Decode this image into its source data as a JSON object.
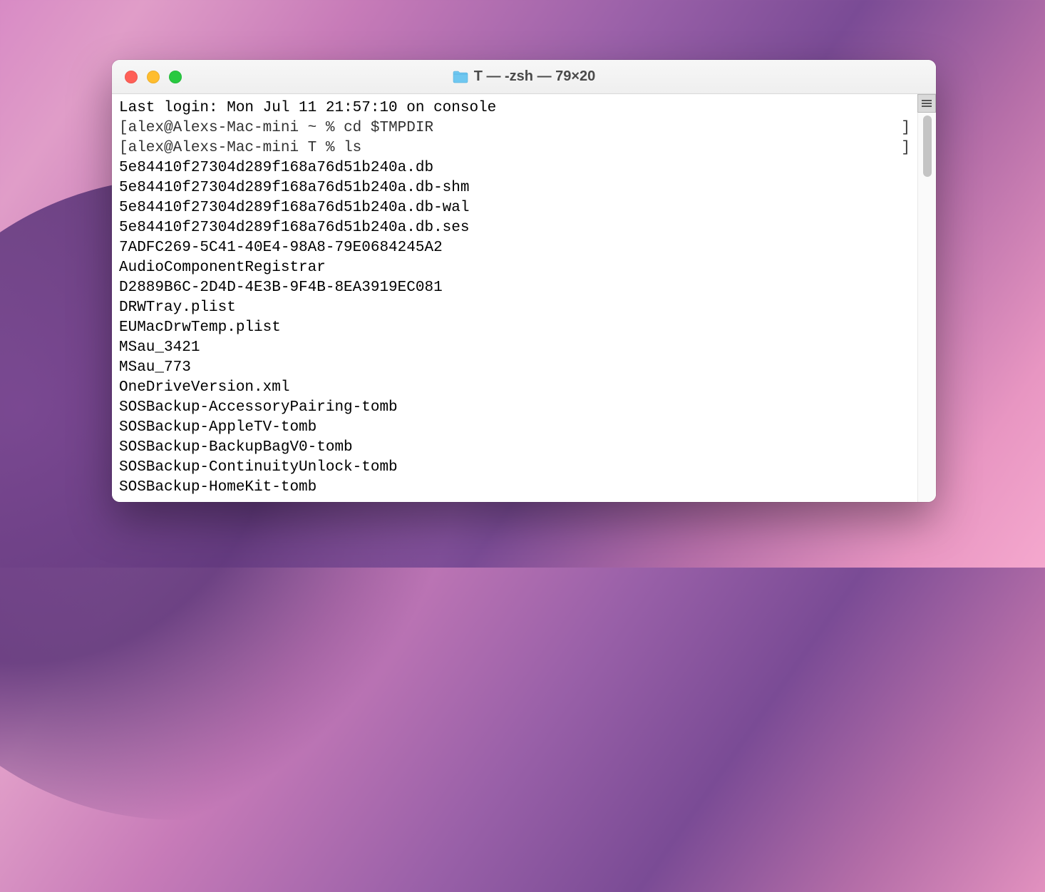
{
  "window": {
    "title": "T — -zsh — 79×20"
  },
  "terminal": {
    "last_login_line": "Last login: Mon Jul 11 21:57:10 on console",
    "prompts": [
      {
        "left": "[alex@Alexs-Mac-mini ~ % ",
        "cmd": "cd $TMPDIR",
        "right": "]"
      },
      {
        "left": "[alex@Alexs-Mac-mini T % ",
        "cmd": "ls",
        "right": "]"
      }
    ],
    "output_lines": [
      "5e84410f27304d289f168a76d51b240a.db",
      "5e84410f27304d289f168a76d51b240a.db-shm",
      "5e84410f27304d289f168a76d51b240a.db-wal",
      "5e84410f27304d289f168a76d51b240a.db.ses",
      "7ADFC269-5C41-40E4-98A8-79E0684245A2",
      "AudioComponentRegistrar",
      "D2889B6C-2D4D-4E3B-9F4B-8EA3919EC081",
      "DRWTray.plist",
      "EUMacDrwTemp.plist",
      "MSau_3421",
      "MSau_773",
      "OneDriveVersion.xml",
      "SOSBackup-AccessoryPairing-tomb",
      "SOSBackup-AppleTV-tomb",
      "SOSBackup-BackupBagV0-tomb",
      "SOSBackup-ContinuityUnlock-tomb",
      "SOSBackup-HomeKit-tomb"
    ]
  }
}
